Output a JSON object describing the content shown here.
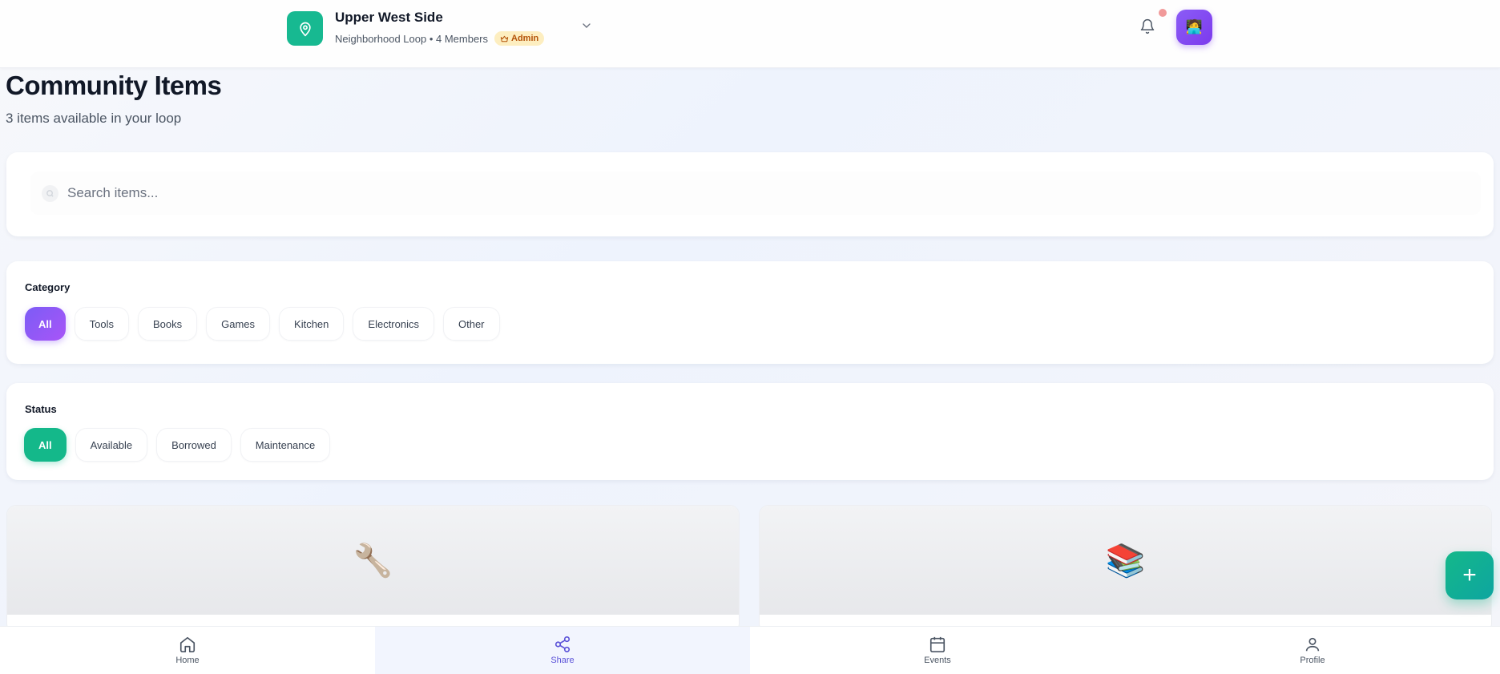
{
  "header": {
    "loop_name": "Upper West Side",
    "loop_subtitle": "Neighborhood Loop • 4 Members",
    "role_badge": "Admin",
    "location_icon": "map-pin-icon",
    "avatar_emoji": "🧑‍💻"
  },
  "page": {
    "title": "Community Items",
    "subtitle": "3 items available in your loop"
  },
  "search": {
    "placeholder": "Search items...",
    "value": ""
  },
  "category": {
    "label": "Category",
    "options": [
      "All",
      "Tools",
      "Books",
      "Games",
      "Kitchen",
      "Electronics",
      "Other"
    ],
    "selected": "All"
  },
  "status": {
    "label": "Status",
    "options": [
      "All",
      "Available",
      "Borrowed",
      "Maintenance"
    ],
    "selected": "All"
  },
  "items": [
    {
      "emoji": "🔧"
    },
    {
      "emoji": "📚"
    }
  ],
  "fab": {
    "label": "+"
  },
  "nav": {
    "items": [
      {
        "label": "Home",
        "icon": "home-icon"
      },
      {
        "label": "Share",
        "icon": "share-icon"
      },
      {
        "label": "Events",
        "icon": "calendar-icon"
      },
      {
        "label": "Profile",
        "icon": "user-icon"
      }
    ],
    "active": "Share"
  },
  "colors": {
    "accent_green": "#14b88a",
    "accent_purple": "#7c5cf6",
    "admin_badge_bg": "#fdeec0",
    "nav_active": "#5b52d8"
  }
}
